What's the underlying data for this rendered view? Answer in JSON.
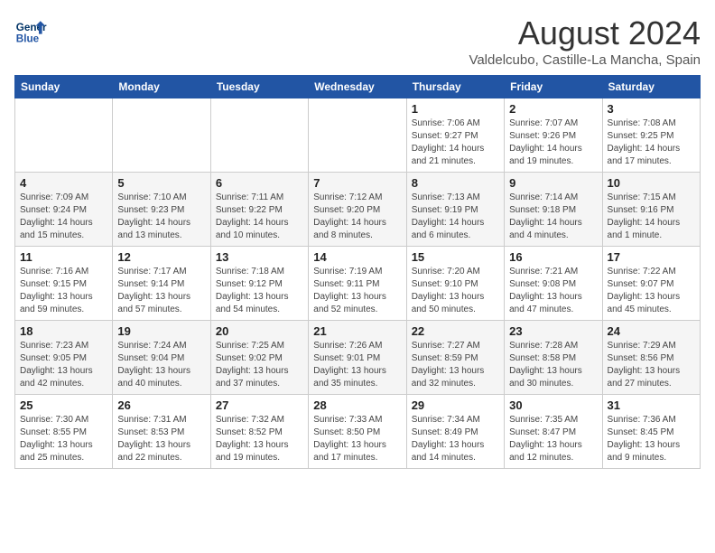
{
  "header": {
    "logo_line1": "General",
    "logo_line2": "Blue",
    "title": "August 2024",
    "subtitle": "Valdelcubo, Castille-La Mancha, Spain"
  },
  "weekdays": [
    "Sunday",
    "Monday",
    "Tuesday",
    "Wednesday",
    "Thursday",
    "Friday",
    "Saturday"
  ],
  "weeks": [
    [
      {
        "day": "",
        "info": ""
      },
      {
        "day": "",
        "info": ""
      },
      {
        "day": "",
        "info": ""
      },
      {
        "day": "",
        "info": ""
      },
      {
        "day": "1",
        "info": "Sunrise: 7:06 AM\nSunset: 9:27 PM\nDaylight: 14 hours\nand 21 minutes."
      },
      {
        "day": "2",
        "info": "Sunrise: 7:07 AM\nSunset: 9:26 PM\nDaylight: 14 hours\nand 19 minutes."
      },
      {
        "day": "3",
        "info": "Sunrise: 7:08 AM\nSunset: 9:25 PM\nDaylight: 14 hours\nand 17 minutes."
      }
    ],
    [
      {
        "day": "4",
        "info": "Sunrise: 7:09 AM\nSunset: 9:24 PM\nDaylight: 14 hours\nand 15 minutes."
      },
      {
        "day": "5",
        "info": "Sunrise: 7:10 AM\nSunset: 9:23 PM\nDaylight: 14 hours\nand 13 minutes."
      },
      {
        "day": "6",
        "info": "Sunrise: 7:11 AM\nSunset: 9:22 PM\nDaylight: 14 hours\nand 10 minutes."
      },
      {
        "day": "7",
        "info": "Sunrise: 7:12 AM\nSunset: 9:20 PM\nDaylight: 14 hours\nand 8 minutes."
      },
      {
        "day": "8",
        "info": "Sunrise: 7:13 AM\nSunset: 9:19 PM\nDaylight: 14 hours\nand 6 minutes."
      },
      {
        "day": "9",
        "info": "Sunrise: 7:14 AM\nSunset: 9:18 PM\nDaylight: 14 hours\nand 4 minutes."
      },
      {
        "day": "10",
        "info": "Sunrise: 7:15 AM\nSunset: 9:16 PM\nDaylight: 14 hours\nand 1 minute."
      }
    ],
    [
      {
        "day": "11",
        "info": "Sunrise: 7:16 AM\nSunset: 9:15 PM\nDaylight: 13 hours\nand 59 minutes."
      },
      {
        "day": "12",
        "info": "Sunrise: 7:17 AM\nSunset: 9:14 PM\nDaylight: 13 hours\nand 57 minutes."
      },
      {
        "day": "13",
        "info": "Sunrise: 7:18 AM\nSunset: 9:12 PM\nDaylight: 13 hours\nand 54 minutes."
      },
      {
        "day": "14",
        "info": "Sunrise: 7:19 AM\nSunset: 9:11 PM\nDaylight: 13 hours\nand 52 minutes."
      },
      {
        "day": "15",
        "info": "Sunrise: 7:20 AM\nSunset: 9:10 PM\nDaylight: 13 hours\nand 50 minutes."
      },
      {
        "day": "16",
        "info": "Sunrise: 7:21 AM\nSunset: 9:08 PM\nDaylight: 13 hours\nand 47 minutes."
      },
      {
        "day": "17",
        "info": "Sunrise: 7:22 AM\nSunset: 9:07 PM\nDaylight: 13 hours\nand 45 minutes."
      }
    ],
    [
      {
        "day": "18",
        "info": "Sunrise: 7:23 AM\nSunset: 9:05 PM\nDaylight: 13 hours\nand 42 minutes."
      },
      {
        "day": "19",
        "info": "Sunrise: 7:24 AM\nSunset: 9:04 PM\nDaylight: 13 hours\nand 40 minutes."
      },
      {
        "day": "20",
        "info": "Sunrise: 7:25 AM\nSunset: 9:02 PM\nDaylight: 13 hours\nand 37 minutes."
      },
      {
        "day": "21",
        "info": "Sunrise: 7:26 AM\nSunset: 9:01 PM\nDaylight: 13 hours\nand 35 minutes."
      },
      {
        "day": "22",
        "info": "Sunrise: 7:27 AM\nSunset: 8:59 PM\nDaylight: 13 hours\nand 32 minutes."
      },
      {
        "day": "23",
        "info": "Sunrise: 7:28 AM\nSunset: 8:58 PM\nDaylight: 13 hours\nand 30 minutes."
      },
      {
        "day": "24",
        "info": "Sunrise: 7:29 AM\nSunset: 8:56 PM\nDaylight: 13 hours\nand 27 minutes."
      }
    ],
    [
      {
        "day": "25",
        "info": "Sunrise: 7:30 AM\nSunset: 8:55 PM\nDaylight: 13 hours\nand 25 minutes."
      },
      {
        "day": "26",
        "info": "Sunrise: 7:31 AM\nSunset: 8:53 PM\nDaylight: 13 hours\nand 22 minutes."
      },
      {
        "day": "27",
        "info": "Sunrise: 7:32 AM\nSunset: 8:52 PM\nDaylight: 13 hours\nand 19 minutes."
      },
      {
        "day": "28",
        "info": "Sunrise: 7:33 AM\nSunset: 8:50 PM\nDaylight: 13 hours\nand 17 minutes."
      },
      {
        "day": "29",
        "info": "Sunrise: 7:34 AM\nSunset: 8:49 PM\nDaylight: 13 hours\nand 14 minutes."
      },
      {
        "day": "30",
        "info": "Sunrise: 7:35 AM\nSunset: 8:47 PM\nDaylight: 13 hours\nand 12 minutes."
      },
      {
        "day": "31",
        "info": "Sunrise: 7:36 AM\nSunset: 8:45 PM\nDaylight: 13 hours\nand 9 minutes."
      }
    ]
  ]
}
